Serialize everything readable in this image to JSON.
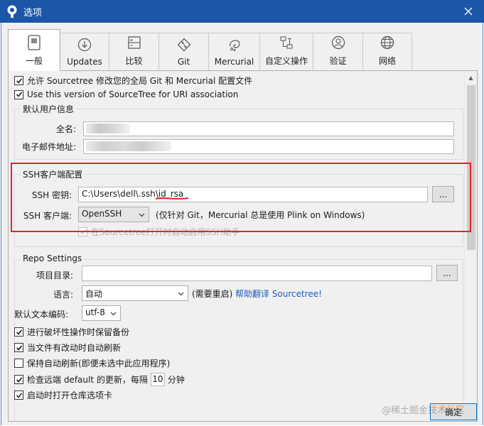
{
  "window": {
    "title": "选项",
    "close_icon": "close-icon",
    "app_icon": "sourcetree-icon"
  },
  "tabs": [
    {
      "label": "一般",
      "icon": "switch-icon",
      "active": true
    },
    {
      "label": "Updates",
      "icon": "download-circle-icon"
    },
    {
      "label": "比较",
      "icon": "diff-icon"
    },
    {
      "label": "Git",
      "icon": "git-icon"
    },
    {
      "label": "Mercurial",
      "icon": "mercurial-icon"
    },
    {
      "label": "自定义操作",
      "icon": "flow-icon"
    },
    {
      "label": "验证",
      "icon": "user-icon"
    },
    {
      "label": "网络",
      "icon": "globe-icon"
    }
  ],
  "general": {
    "allow_modify": {
      "label": "允许 Sourcetree 修改您的全局 Git 和 Mercurial 配置文件",
      "checked": true
    },
    "uri_association": {
      "label": "Use this version of SourceTree for URI association",
      "checked": true
    }
  },
  "user_info": {
    "title": "默认用户信息",
    "fullname_label": "全名:",
    "email_label": "电子邮件地址:"
  },
  "ssh": {
    "title": "SSH客户端配置",
    "key_label": "SSH 密钥:",
    "key_value": "C:\\Users\\dell\\.ssh\\id_rsa",
    "browse_label": "...",
    "client_label": "SSH 客户端:",
    "client_value": "OpenSSH",
    "client_note": "(仅针对 Git，Mercurial 总是使用 Plink on Windows)",
    "auto_agent": {
      "label": "在Sourcetree打开时自动启用SSH助手",
      "checked": true,
      "disabled": true
    }
  },
  "repo": {
    "title": "Repo Settings",
    "project_dir_label": "项目目录:",
    "project_dir_value": "",
    "browse_label": "...",
    "language_label": "语言:",
    "language_value": "自动",
    "restart_note": "(需要重启)",
    "translate_link": "帮助翻译 Sourcetree!",
    "encoding_label": "默认文本编码:",
    "encoding_value": "utf-8",
    "backup": {
      "label": "进行破坏性操作时保留备份",
      "checked": true
    },
    "auto_refresh": {
      "label": "当文件有改动时自动刷新",
      "checked": true
    },
    "keep_refresh": {
      "label": "保持自动刷新(即便未选中此应用程序)",
      "checked": false
    },
    "check_remote_prefix": "检查远端 default 的更新，每隔",
    "check_remote_value": "10",
    "check_remote_unit": "分钟",
    "check_remote_checked": true,
    "open_repo_tabs": {
      "label": "启动时打开仓库选项卡",
      "checked": true
    }
  },
  "footer": {
    "ok_label": "确定",
    "watermark": "@稀土掘金技术社区"
  },
  "colors": {
    "titlebar": "#1c56a8",
    "highlight": "#e3242b",
    "link": "#1e5dbb"
  }
}
